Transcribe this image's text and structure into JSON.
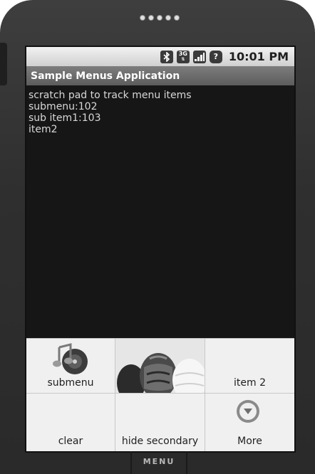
{
  "status_bar": {
    "time": "10:01 PM",
    "icons": [
      "bluetooth-icon",
      "3g-icon",
      "signal-icon",
      "question-icon"
    ]
  },
  "app": {
    "title": "Sample Menus Application"
  },
  "content": {
    "lines": [
      "scratch pad to track menu items",
      "submenu:102",
      "sub item1:103",
      "item2"
    ]
  },
  "menu": {
    "items": [
      {
        "label": "submenu",
        "icon": "music-icon"
      },
      {
        "label": "",
        "icon": "balloons-image"
      },
      {
        "label": "item 2",
        "icon": ""
      },
      {
        "label": "clear",
        "icon": ""
      },
      {
        "label": "hide secondary",
        "icon": ""
      },
      {
        "label": "More",
        "icon": "more-icon"
      }
    ]
  },
  "device": {
    "menu_key_label": "MENU"
  }
}
